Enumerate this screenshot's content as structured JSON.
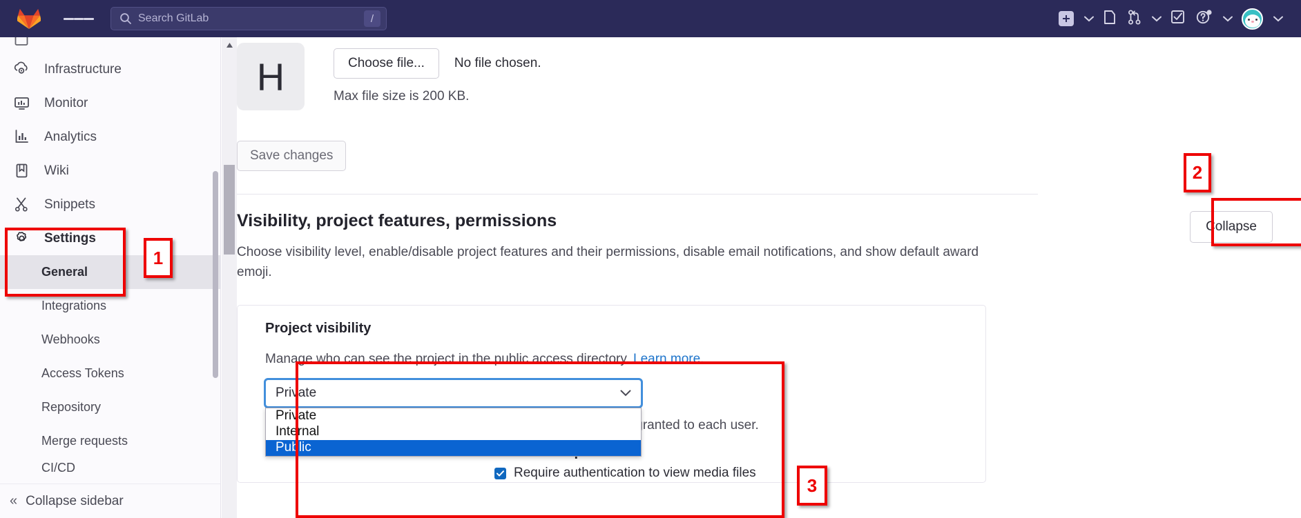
{
  "topbar": {
    "logo": "gitlab-fox-logo",
    "menu_icon": "hamburger-icon",
    "search": {
      "placeholder": "Search GitLab",
      "shortcut_key": "/",
      "icon": "search-icon"
    },
    "actions": [
      {
        "name": "create-new-button",
        "icon": "plus-square-icon",
        "has_chevron": true
      },
      {
        "name": "issues-button",
        "icon": "issues-page-icon",
        "has_chevron": false
      },
      {
        "name": "merge-requests-button",
        "icon": "merge-request-icon",
        "has_chevron": true
      },
      {
        "name": "todos-button",
        "icon": "todo-checkbox-icon",
        "has_chevron": false
      },
      {
        "name": "help-button",
        "icon": "question-circle-icon",
        "has_chevron": true
      },
      {
        "name": "user-avatar-button",
        "icon": "avatar-icon",
        "has_chevron": true
      }
    ]
  },
  "sidebar": {
    "items": [
      {
        "label": "Infrastructure",
        "icon": "infrastructure-icon"
      },
      {
        "label": "Monitor",
        "icon": "monitor-icon"
      },
      {
        "label": "Analytics",
        "icon": "analytics-chart-icon"
      },
      {
        "label": "Wiki",
        "icon": "book-icon"
      },
      {
        "label": "Snippets",
        "icon": "scissors-icon"
      },
      {
        "label": "Settings",
        "icon": "gear-icon"
      }
    ],
    "settings_subitems": [
      {
        "label": "General",
        "active": true
      },
      {
        "label": "Integrations",
        "active": false
      },
      {
        "label": "Webhooks",
        "active": false
      },
      {
        "label": "Access Tokens",
        "active": false
      },
      {
        "label": "Repository",
        "active": false
      },
      {
        "label": "Merge requests",
        "active": false
      },
      {
        "label": "CI/CD",
        "active": false
      }
    ],
    "collapse": {
      "label": "Collapse sidebar",
      "icon": "double-chevron-left-icon"
    }
  },
  "main": {
    "avatar_letter": "H",
    "choose_file_label": "Choose file...",
    "no_file_text": "No file chosen.",
    "max_file_size": "Max file size is 200 KB.",
    "save_changes_label": "Save changes",
    "section": {
      "title": "Visibility, project features, permissions",
      "description": "Choose visibility level, enable/disable project features and their permissions, disable email notifications, and show default award emoji.",
      "collapse_label": "Collapse"
    },
    "project_visibility": {
      "card_title": "Project visibility",
      "description_prefix": "Manage who can see the project in the public access directory. ",
      "learn_more": "Learn more",
      "description_suffix": ".",
      "selected_value": "Private",
      "options": [
        {
          "label": "Private",
          "selected": false
        },
        {
          "label": "Internal",
          "selected": false
        },
        {
          "label": "Public",
          "selected": true
        }
      ],
      "permission_note": "tly granted to each user.",
      "additional_options_title": "Additional options",
      "require_auth_label": "Require authentication to view media files",
      "require_auth_checked": true,
      "chevron_icon": "chevron-down-icon"
    }
  },
  "annotations": [
    {
      "number": "1"
    },
    {
      "number": "2"
    },
    {
      "number": "3"
    }
  ],
  "colors": {
    "nav_background": "#2b2a59",
    "accent_link": "#1f75cb",
    "annotation_red": "#ee0000",
    "option_highlight": "#0a64d2",
    "focus_ring": "#428fdc",
    "checkbox_blue": "#1068bf"
  }
}
